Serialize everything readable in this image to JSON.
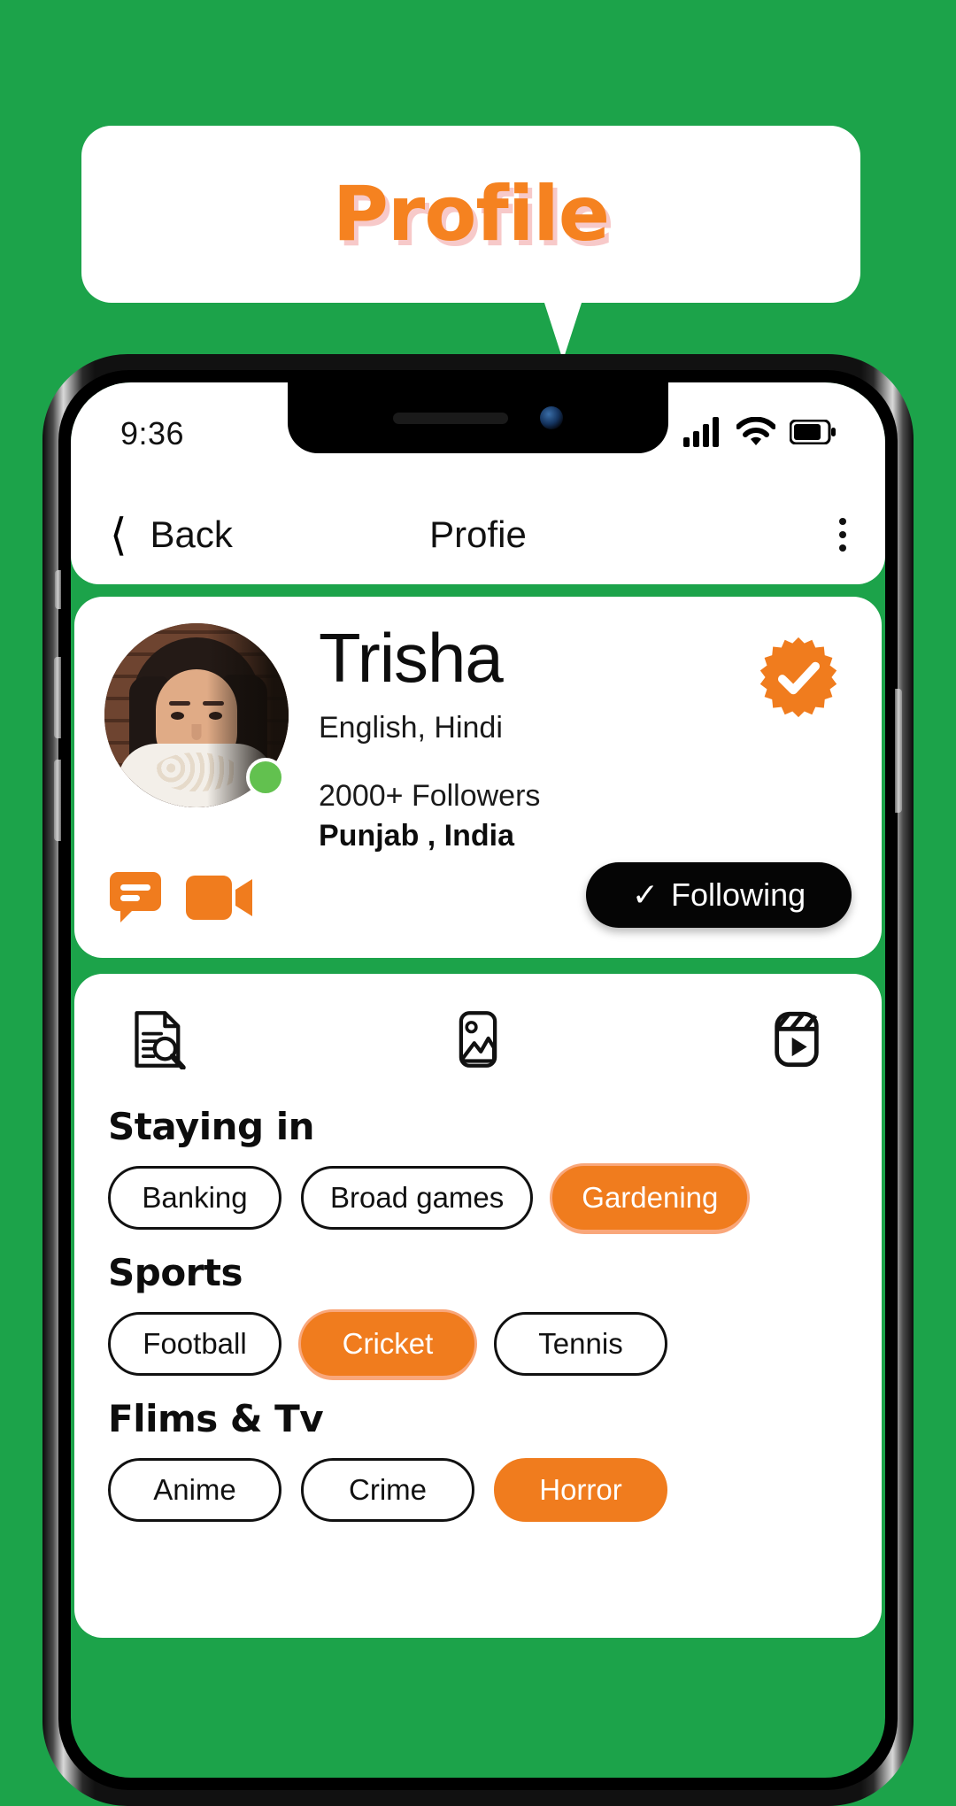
{
  "banner": {
    "title": "Profile",
    "title_color": "#F58220",
    "shadow_color": "#F7C9C9"
  },
  "theme": {
    "background_green": "#1CA34A",
    "accent_orange": "#F07C1E",
    "online_green": "#62C14F",
    "card_white": "#FFFFFF",
    "text_black": "#0D0D0D"
  },
  "status_bar": {
    "time": "9:36",
    "icons": [
      "signal-bars-icon",
      "wifi-icon",
      "battery-icon"
    ]
  },
  "nav": {
    "back_label": "Back",
    "back_icon": "chevron-left-icon",
    "title": "Profie",
    "menu_icon": "more-vertical-icon"
  },
  "profile": {
    "name": "Trisha",
    "languages": "English, Hindi",
    "followers": "2000+ Followers",
    "location": "Punjab , India",
    "verified_icon": "verified-badge-icon",
    "online_status_icon": "online-dot-icon",
    "actions": [
      {
        "icon": "chat-icon",
        "name": "chat-button"
      },
      {
        "icon": "video-call-icon",
        "name": "video-call-button"
      }
    ],
    "follow_button": {
      "label": "Following",
      "check_icon": "check-icon"
    }
  },
  "tabs": [
    {
      "icon": "document-search-icon",
      "name": "tab-about"
    },
    {
      "icon": "photo-icon",
      "name": "tab-photos"
    },
    {
      "icon": "reels-play-icon",
      "name": "tab-reels"
    }
  ],
  "sections": [
    {
      "title": "Staying in",
      "chips": [
        {
          "label": "Banking",
          "selected": false
        },
        {
          "label": "Broad games",
          "selected": false
        },
        {
          "label": "Gardening",
          "selected": true
        }
      ]
    },
    {
      "title": "Sports",
      "chips": [
        {
          "label": "Football",
          "selected": false
        },
        {
          "label": "Cricket",
          "selected": true
        },
        {
          "label": "Tennis",
          "selected": false
        }
      ]
    },
    {
      "title": "Flims & Tv",
      "chips": [
        {
          "label": "Anime",
          "selected": false
        },
        {
          "label": "Crime",
          "selected": false
        },
        {
          "label": "Horror",
          "selected": true
        }
      ]
    }
  ]
}
